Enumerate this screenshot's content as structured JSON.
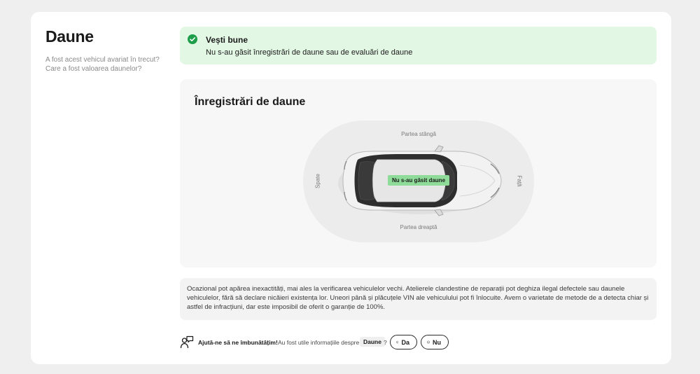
{
  "section": {
    "title": "Daune",
    "subtitle": "A fost acest vehicul avariat în trecut? Care a fost valoarea daunelor?"
  },
  "alert": {
    "title": "Vești bune",
    "text": "Nu s-au găsit înregistrări de daune sau de evaluări de daune",
    "icon": "check-circle-icon",
    "color": "#1e9e4a"
  },
  "damage_records": {
    "title": "Înregistrări de daune",
    "labels": {
      "left": "Partea stângă",
      "right": "Partea dreaptă",
      "back": "Spate",
      "front": "Față"
    },
    "badge": "Nu s-au găsit daune"
  },
  "disclaimer": "Ocazional pot apărea inexactități, mai ales la verificarea vehiculelor vechi. Atelierele clandestine de reparații pot deghiza ilegal defectele sau daunele vehiculelor, fără să declare nicăieri existența lor. Uneori până și plăcuțele VIN ale vehiculului pot fi înlocuite. Avem o varietate de metode de a detecta chiar și astfel de infracțiuni, dar este imposibil de oferit o garanție de 100%.",
  "feedback": {
    "strong": "Ajută-ne să ne îmbunătățim!",
    "question": "Au fost utile informațiile despre",
    "chip": "Daune",
    "qmark": "?",
    "yes_label": "Da",
    "no_label": "Nu"
  }
}
